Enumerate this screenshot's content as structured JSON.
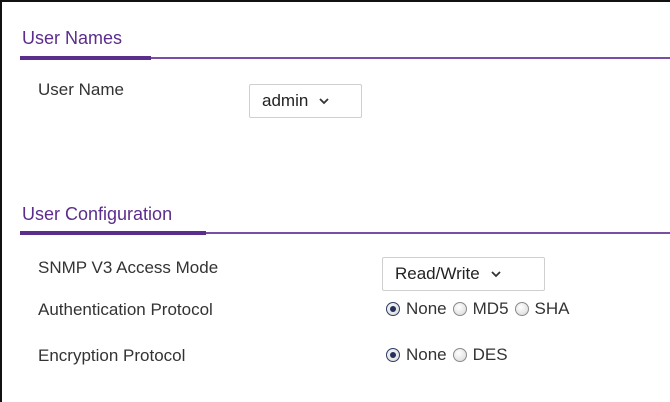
{
  "user_names": {
    "title": "User Names",
    "user_name_label": "User Name",
    "user_name_value": "admin"
  },
  "user_configuration": {
    "title": "User Configuration",
    "snmp_label": "SNMP V3 Access Mode",
    "snmp_value": "Read/Write",
    "auth_label": "Authentication Protocol",
    "auth_options": [
      "None",
      "MD5",
      "SHA"
    ],
    "auth_selected": "None",
    "enc_label": "Encryption Protocol",
    "enc_options": [
      "None",
      "DES"
    ],
    "enc_selected": "None"
  },
  "colors": {
    "accent": "#5b2d8c",
    "text": "#333333"
  },
  "icons": {
    "select_arrow": "chevron-down-icon",
    "radio": "radio-button-icon"
  }
}
